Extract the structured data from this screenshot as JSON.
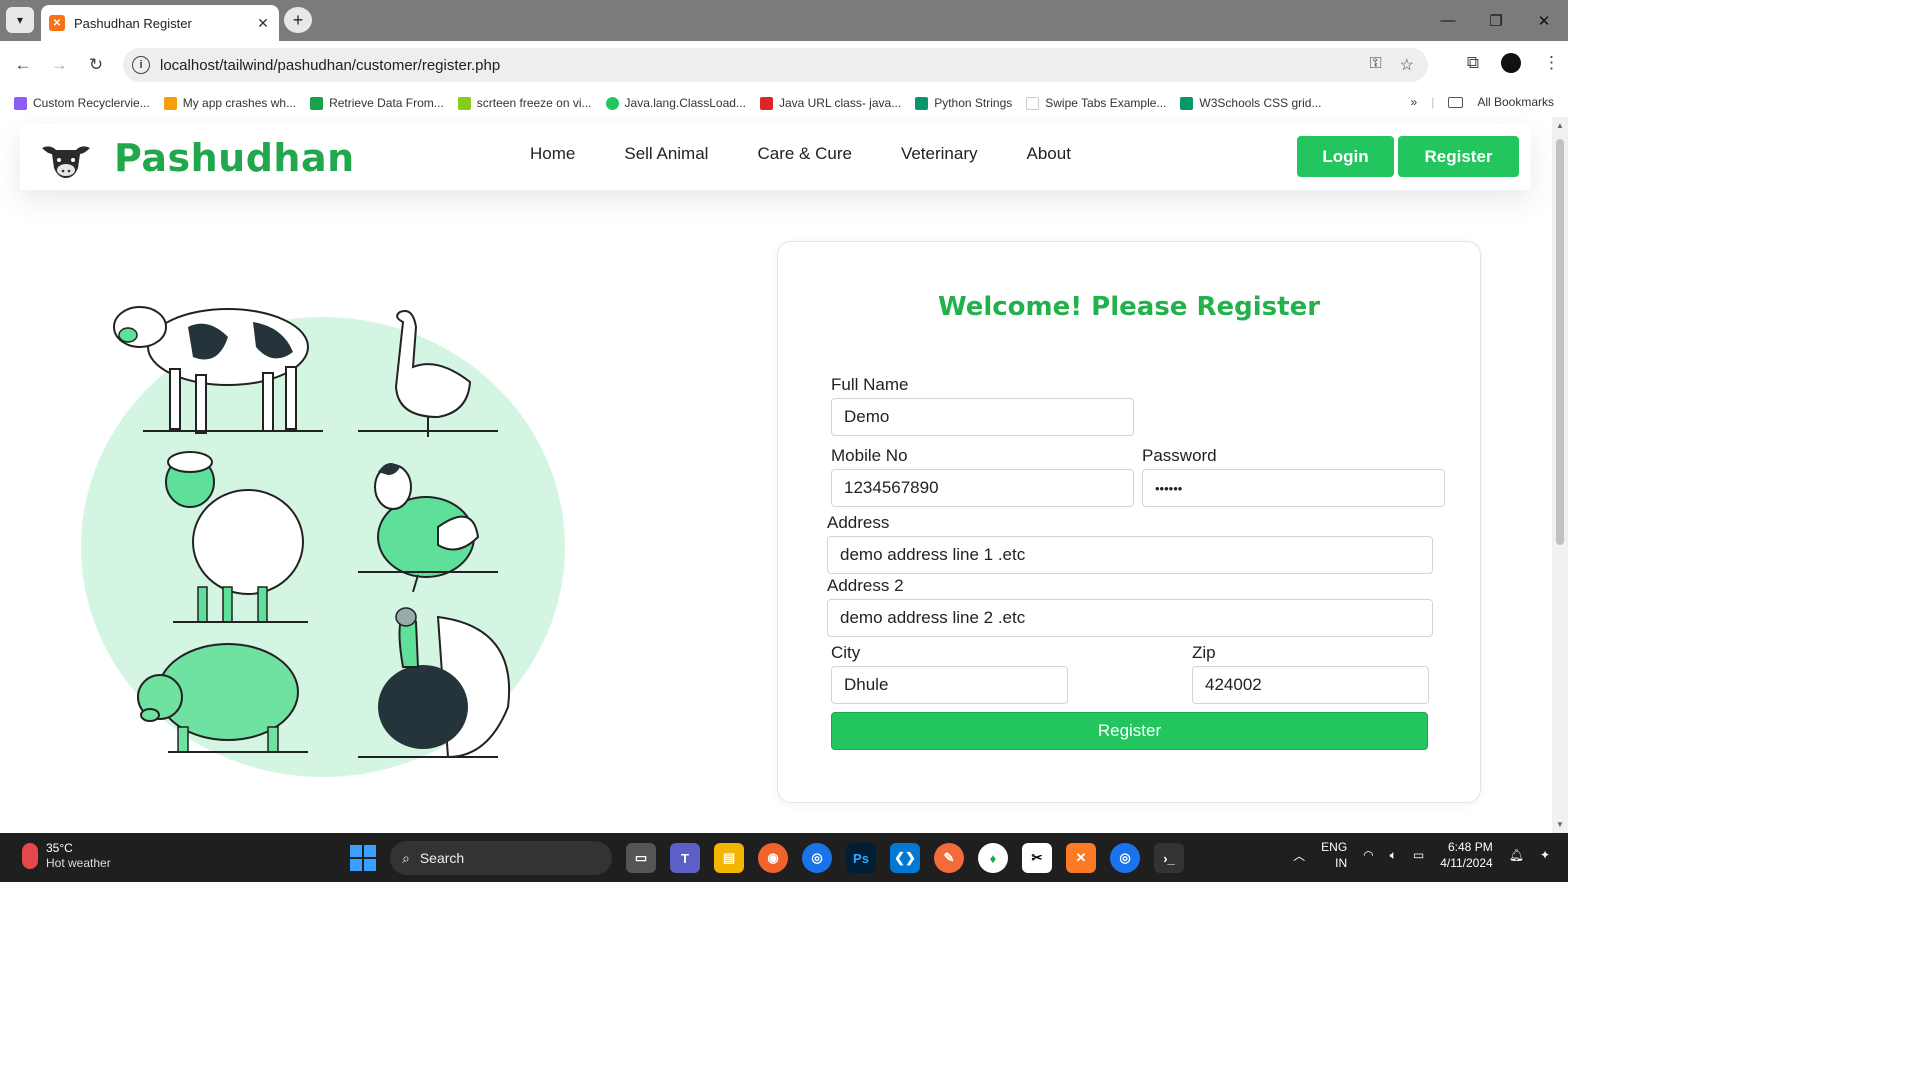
{
  "browser": {
    "tab_title": "Pashudhan Register",
    "url": "localhost/tailwind/pashudhan/customer/register.php",
    "bookmarks": [
      {
        "label": "Custom Recyclervie...",
        "color": "#8b5cf6"
      },
      {
        "label": "My app crashes wh...",
        "color": "#f59e0b"
      },
      {
        "label": "Retrieve Data From...",
        "color": "#16a34a"
      },
      {
        "label": "scrteen freeze on vi...",
        "color": "#84cc16"
      },
      {
        "label": "Java.lang.ClassLoad...",
        "color": "#22c55e"
      },
      {
        "label": "Java URL class- java...",
        "color": "#dc2626"
      },
      {
        "label": "Python Strings",
        "color": "#059669"
      },
      {
        "label": "Swipe Tabs Example...",
        "color": "#ffffff"
      },
      {
        "label": "W3Schools CSS grid...",
        "color": "#059669"
      }
    ],
    "all_bookmarks": "All Bookmarks"
  },
  "site": {
    "brand": "Pashudhan",
    "menu": [
      "Home",
      "Sell Animal",
      "Care & Cure",
      "Veterinary",
      "About"
    ],
    "login_label": "Login",
    "register_label": "Register"
  },
  "form": {
    "title": "Welcome! Please Register",
    "full_name_label": "Full Name",
    "full_name_value": "Demo",
    "mobile_label": "Mobile No",
    "mobile_value": "1234567890",
    "password_label": "Password",
    "password_value": "••••••",
    "address_label": "Address",
    "address_value": "demo address line 1 .etc",
    "address2_label": "Address 2",
    "address2_value": "demo address line 2 .etc",
    "city_label": "City",
    "city_value": "Dhule",
    "zip_label": "Zip",
    "zip_value": "424002",
    "submit_label": "Register"
  },
  "colors": {
    "accent": "#22c55e",
    "brand": "#21a84d"
  },
  "taskbar": {
    "temperature": "35°C",
    "weather": "Hot weather",
    "search": "Search",
    "lang": "ENG",
    "region": "IN",
    "time": "6:48 PM",
    "date": "4/11/2024"
  }
}
